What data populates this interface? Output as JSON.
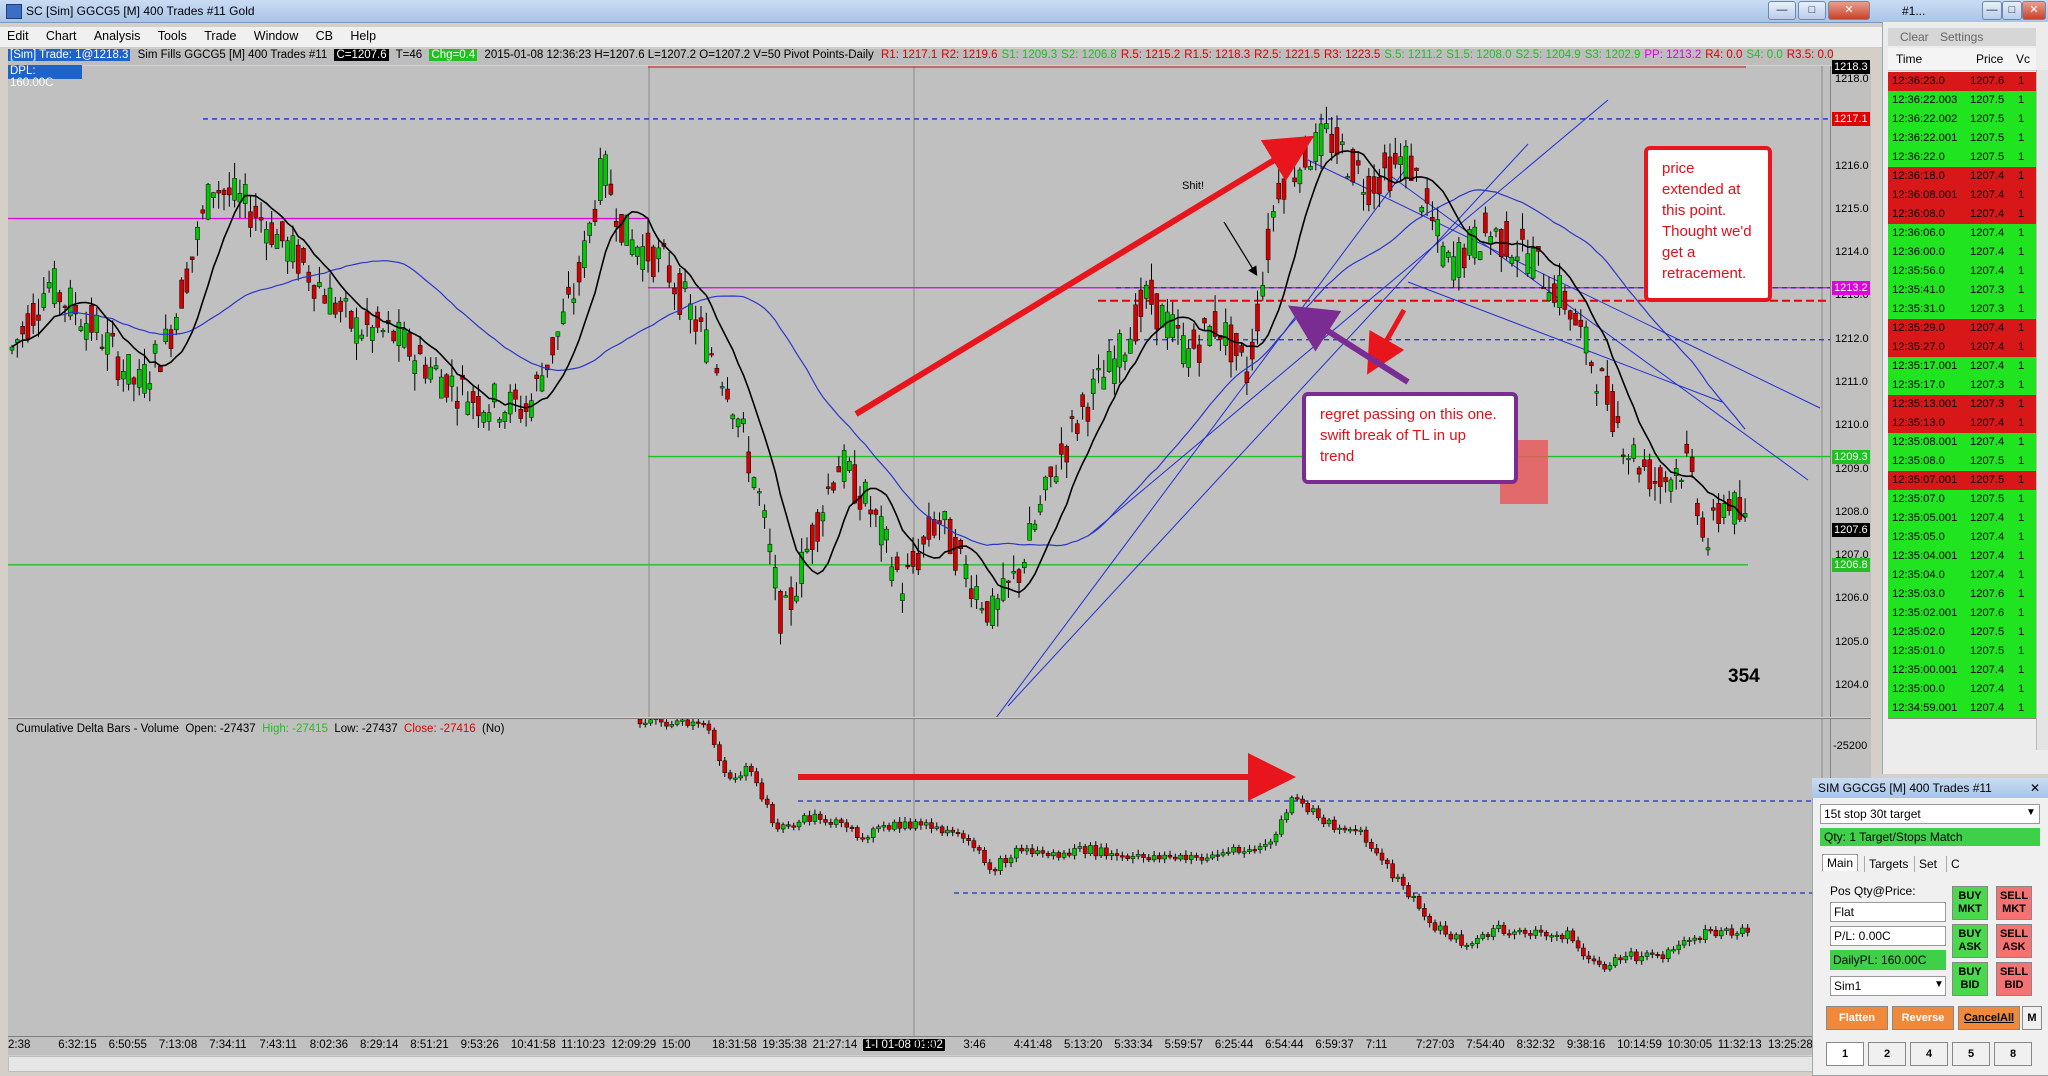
{
  "window": {
    "title": "SC [Sim] GGCG5 [M]  400 Trades  #11  Gold",
    "controls": [
      "—",
      "□",
      "✕"
    ]
  },
  "menu": [
    "Edit",
    "Chart",
    "Analysis",
    "Tools",
    "Trade",
    "Window",
    "CB",
    "Help"
  ],
  "infobar": {
    "sim_trade": "[Sim]  Trade: 1@1218.3",
    "sim_fills": "Sim Fills  GGCG5 [M]  400 Trades  #11",
    "close": "C=1207.6",
    "ticks": "T=46",
    "chg": "Chg=0.4",
    "stats": "2015-01-08 12:36:23 H=1207.6 L=1207.2 O=1207.2 V=50 Pivot Points-Daily",
    "pivots": [
      {
        "t": "R1: 1217.1",
        "c": "#e00000"
      },
      {
        "t": "R2: 1219.6",
        "c": "#e00000"
      },
      {
        "t": "S1: 1209.3",
        "c": "#22c022"
      },
      {
        "t": "S2: 1206.8",
        "c": "#22c022"
      },
      {
        "t": "R.5: 1215.2",
        "c": "#e00000"
      },
      {
        "t": "R1.5: 1218.3",
        "c": "#e00000"
      },
      {
        "t": "R2.5: 1221.5",
        "c": "#e00000"
      },
      {
        "t": "R3: 1223.5",
        "c": "#e00000"
      },
      {
        "t": "S.5: 1211.2",
        "c": "#22c022"
      },
      {
        "t": "S1.5: 1208.0",
        "c": "#22c022"
      },
      {
        "t": "S2.5: 1204.9",
        "c": "#22c022"
      },
      {
        "t": "S3: 1202.9",
        "c": "#22c022"
      },
      {
        "t": "PP: 1213.2",
        "c": "#e000e0"
      },
      {
        "t": "R4: 0.0",
        "c": "#e00000"
      },
      {
        "t": "S4: 0.0",
        "c": "#22c022"
      },
      {
        "t": "R3.5: 0.0",
        "c": "#e00000"
      },
      {
        "t": "S3.5: 0.0",
        "c": "#22c022"
      }
    ],
    "dpl": "DPL: 160.00C"
  },
  "price_axis": {
    "labels": [
      "1218.0",
      "1217.0",
      "1216.0",
      "1215.0",
      "1214.0",
      "1213.0",
      "1212.0",
      "1211.0",
      "1210.0",
      "1209.0",
      "1208.0",
      "1207.0",
      "1206.0",
      "1205.0",
      "1204.0"
    ],
    "tags": [
      {
        "t": "1218.3",
        "price": 1218.3,
        "bg": "#000000",
        "fg": "#ffffff"
      },
      {
        "t": "1217.1",
        "price": 1217.1,
        "bg": "#e00000",
        "fg": "#ffffff"
      },
      {
        "t": "1213.2",
        "price": 1213.2,
        "bg": "#e000e0",
        "fg": "#ffffff"
      },
      {
        "t": "1209.3",
        "price": 1209.3,
        "bg": "#22c022",
        "fg": "#ffffff"
      },
      {
        "t": "1207.6",
        "price": 1207.6,
        "bg": "#000000",
        "fg": "#ffffff"
      },
      {
        "t": "1206.8",
        "price": 1206.8,
        "bg": "#22c022",
        "fg": "#ffffff"
      }
    ]
  },
  "bar_count": "354",
  "delta": {
    "header_name": "Cumulative Delta Bars - Volume",
    "open": "Open: -27437",
    "high": "High: -27415",
    "low": "Low: -27437",
    "close": "Close: -27416",
    "no": "(No)",
    "axis_label": "-25200"
  },
  "time_axis": [
    "2:38",
    "6:32:15",
    "6:50:55",
    "7:13:08",
    "7:34:11",
    "7:43:11",
    "8:02:36",
    "8:29:14",
    "8:51:21",
    "9:53:26",
    "10:41:58",
    "11:10:23",
    "12:09:29",
    "15:00",
    "18:31:58",
    "19:35:38",
    "21:27:14",
    "1-I 01-08  01:02",
    "0:55",
    "3:46",
    "4:41:48",
    "5:13:20",
    "5:33:34",
    "5:59:57",
    "6:25:44",
    "6:54:44",
    "6:59:37",
    "7:11",
    "7:27:03",
    "7:54:40",
    "8:32:32",
    "9:38:16",
    "10:14:59",
    "10:30:05",
    "11:32:13",
    "13:25:28"
  ],
  "annotations": {
    "shit": "Shit!",
    "note_extended": "price extended at this point. Thought we'd get a retracement.",
    "note_regret": "regret passing on this one. swift break of TL in up trend"
  },
  "time_and_sales": {
    "title": "#1...",
    "clear": "Clear",
    "settings": "Settings",
    "col_time": "Time",
    "col_price": "Price",
    "col_vol": "Vc",
    "rows": [
      {
        "time": "12:36:23.0",
        "price": "1207.6",
        "vol": "1",
        "side": "sell"
      },
      {
        "time": "12:36:22.003",
        "price": "1207.5",
        "vol": "1",
        "side": "buy"
      },
      {
        "time": "12:36:22.002",
        "price": "1207.5",
        "vol": "1",
        "side": "buy"
      },
      {
        "time": "12:36:22.001",
        "price": "1207.5",
        "vol": "1",
        "side": "buy"
      },
      {
        "time": "12:36:22.0",
        "price": "1207.5",
        "vol": "1",
        "side": "buy"
      },
      {
        "time": "12:36:18.0",
        "price": "1207.4",
        "vol": "1",
        "side": "sell"
      },
      {
        "time": "12:36:08.001",
        "price": "1207.4",
        "vol": "1",
        "side": "sell"
      },
      {
        "time": "12:36:08.0",
        "price": "1207.4",
        "vol": "1",
        "side": "sell"
      },
      {
        "time": "12:36:06.0",
        "price": "1207.4",
        "vol": "1",
        "side": "buy"
      },
      {
        "time": "12:36:00.0",
        "price": "1207.4",
        "vol": "1",
        "side": "buy"
      },
      {
        "time": "12:35:56.0",
        "price": "1207.4",
        "vol": "1",
        "side": "buy"
      },
      {
        "time": "12:35:41.0",
        "price": "1207.3",
        "vol": "1",
        "side": "buy"
      },
      {
        "time": "12:35:31.0",
        "price": "1207.3",
        "vol": "1",
        "side": "buy"
      },
      {
        "time": "12:35:29.0",
        "price": "1207.4",
        "vol": "1",
        "side": "sell"
      },
      {
        "time": "12:35:27.0",
        "price": "1207.4",
        "vol": "1",
        "side": "sell"
      },
      {
        "time": "12:35:17.001",
        "price": "1207.4",
        "vol": "1",
        "side": "buy"
      },
      {
        "time": "12:35:17.0",
        "price": "1207.3",
        "vol": "1",
        "side": "buy"
      },
      {
        "time": "12:35:13.001",
        "price": "1207.3",
        "vol": "1",
        "side": "sell"
      },
      {
        "time": "12:35:13.0",
        "price": "1207.4",
        "vol": "1",
        "side": "sell"
      },
      {
        "time": "12:35:08.001",
        "price": "1207.4",
        "vol": "1",
        "side": "buy"
      },
      {
        "time": "12:35:08.0",
        "price": "1207.5",
        "vol": "1",
        "side": "buy"
      },
      {
        "time": "12:35:07.001",
        "price": "1207.5",
        "vol": "1",
        "side": "sell"
      },
      {
        "time": "12:35:07.0",
        "price": "1207.5",
        "vol": "1",
        "side": "buy"
      },
      {
        "time": "12:35:05.001",
        "price": "1207.4",
        "vol": "1",
        "side": "buy"
      },
      {
        "time": "12:35:05.0",
        "price": "1207.4",
        "vol": "1",
        "side": "buy"
      },
      {
        "time": "12:35:04.001",
        "price": "1207.4",
        "vol": "1",
        "side": "buy"
      },
      {
        "time": "12:35:04.0",
        "price": "1207.4",
        "vol": "1",
        "side": "buy"
      },
      {
        "time": "12:35:03.0",
        "price": "1207.6",
        "vol": "1",
        "side": "buy"
      },
      {
        "time": "12:35:02.001",
        "price": "1207.6",
        "vol": "1",
        "side": "buy"
      },
      {
        "time": "12:35:02.0",
        "price": "1207.5",
        "vol": "1",
        "side": "buy"
      },
      {
        "time": "12:35:01.0",
        "price": "1207.5",
        "vol": "1",
        "side": "buy"
      },
      {
        "time": "12:35:00.001",
        "price": "1207.4",
        "vol": "1",
        "side": "buy"
      },
      {
        "time": "12:35:00.0",
        "price": "1207.4",
        "vol": "1",
        "side": "buy"
      },
      {
        "time": "12:34:59.001",
        "price": "1207.4",
        "vol": "1",
        "side": "buy"
      }
    ]
  },
  "order_entry": {
    "title": "SIM GGCG5 [M]  400 Trades  #11",
    "strategy": "15t stop 30t target",
    "qty": "Qty: 1 Target/Stops Match",
    "tabs": [
      "Main",
      "Targets",
      "Set",
      "C"
    ],
    "pos_label": "Pos Qty@Price:",
    "pos_value": "Flat",
    "pl": "P/L: 0.00C",
    "dailypl": "DailyPL: 160.00C",
    "account": "Sim1",
    "buy_mkt": "BUY MKT",
    "sell_mkt": "SELL MKT",
    "buy_ask": "BUY ASK",
    "sell_ask": "SELL ASK",
    "buy_bid": "BUY BID",
    "sell_bid": "SELL BID",
    "flatten": "Flatten",
    "reverse": "Reverse",
    "cancelall": "CancelAll",
    "m": "M",
    "qty_buttons": [
      "1",
      "2",
      "4",
      "5",
      "8"
    ]
  },
  "colors": {
    "up": "#00c800",
    "down": "#d40000",
    "chart_bg": "#c0c0c0",
    "pivot_blue": "#1f2bd0",
    "annot_red": "#e8161c",
    "annot_purple": "#7a2c92"
  }
}
